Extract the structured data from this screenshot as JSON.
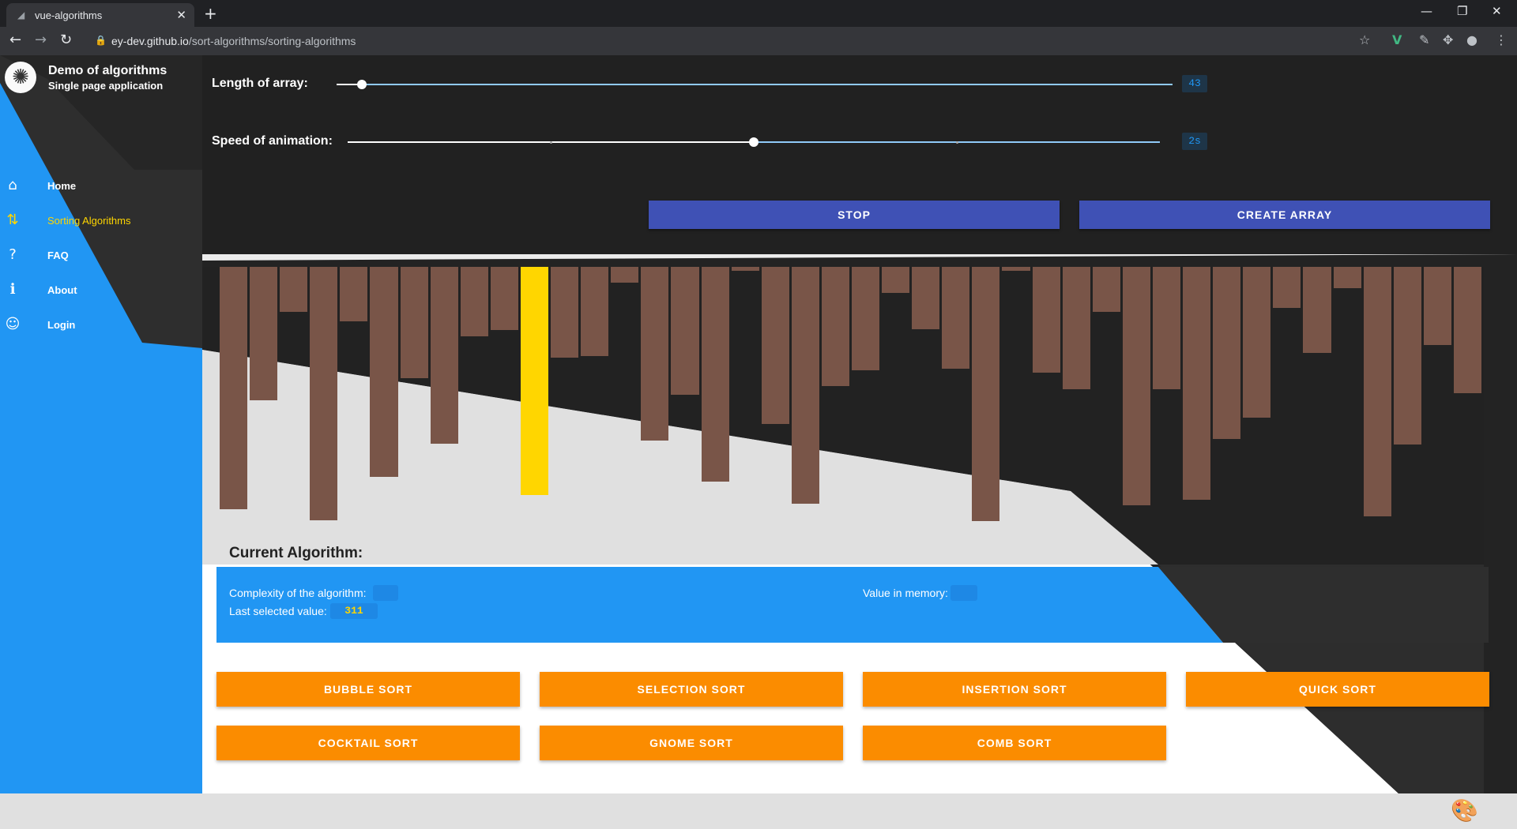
{
  "browser": {
    "tab_title": "vue-algorithms",
    "tab_close": "✕",
    "new_tab": "+",
    "url_host": "ey-dev.github.io",
    "url_path": "/sort-algorithms/sorting-algorithms",
    "window_controls": [
      "—",
      "❐",
      "✕"
    ]
  },
  "sidebar": {
    "title": "Demo of algorithms",
    "subtitle": "Single page application",
    "items": [
      {
        "label": "Home",
        "icon": "⌂"
      },
      {
        "label": "Sorting Algorithms",
        "icon": "⇅"
      },
      {
        "label": "FAQ",
        "icon": "?"
      },
      {
        "label": "About",
        "icon": "ℹ"
      },
      {
        "label": "Login",
        "icon": "☺"
      }
    ]
  },
  "controls": {
    "length_label": "Length of array:",
    "length_value": "43",
    "length_fraction": 0.03,
    "speed_label": "Speed of animation:",
    "speed_value": "2s",
    "speed_fraction": 0.5,
    "stop_label": "STOP",
    "create_label": "CREATE ARRAY"
  },
  "chart_data": {
    "type": "bar",
    "values": [
      330,
      182,
      61,
      345,
      74,
      286,
      152,
      241,
      95,
      86,
      311,
      124,
      121,
      21,
      237,
      174,
      293,
      5,
      214,
      323,
      162,
      141,
      36,
      85,
      139,
      346,
      5,
      144,
      167,
      61,
      325,
      167,
      317,
      234,
      205,
      56,
      117,
      29,
      340,
      242,
      106,
      172
    ],
    "highlighted_index": 10,
    "colors": {
      "bar": "#795548",
      "highlight": "#ffd600"
    }
  },
  "info": {
    "heading": "Current Algorithm:",
    "complexity_label": "Complexity of the algorithm:",
    "complexity_value": "",
    "memory_label": "Value in memory:",
    "memory_value": "",
    "last_label": "Last selected value:",
    "last_value": "311"
  },
  "algorithms": [
    "BUBBLE SORT",
    "SELECTION SORT",
    "INSERTION SORT",
    "QUICK SORT",
    "COCKTAIL SORT",
    "GNOME SORT",
    "COMB SORT"
  ],
  "colors": {
    "accent": "#2196f3",
    "dark": "#212121",
    "button_blue": "#3f51b5",
    "button_orange": "#fb8c00"
  }
}
